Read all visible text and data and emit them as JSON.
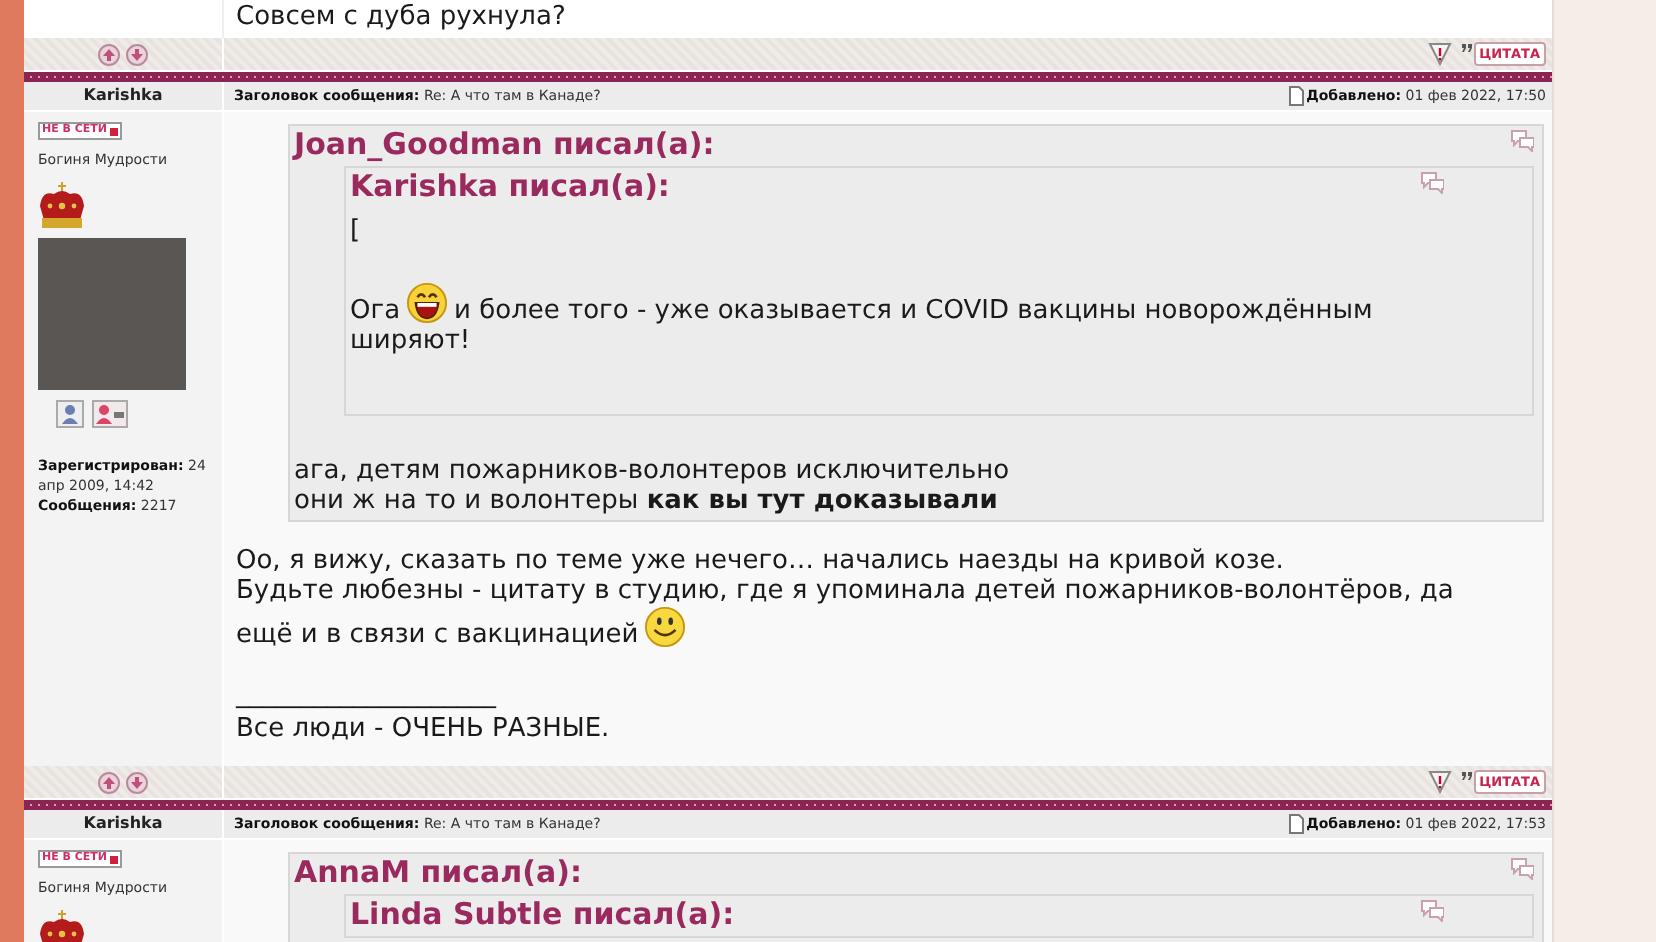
{
  "previous_post": {
    "body_tail": "Совсем с дуба рухнула?",
    "footer": {
      "quote_button": "ЦИТАТА"
    }
  },
  "posts": [
    {
      "author": "Karishka",
      "subject_label": "Заголовок сообщения:",
      "subject": "Re: А что там в Канаде?",
      "added_label": "Добавлено:",
      "added": "01 фев 2022, 17:50",
      "profile": {
        "status_badge": "НЕ В СЕТИ",
        "rank": "Богиня Мудрости",
        "rank_image": true,
        "avatar": true,
        "contact_icons": true,
        "registered_label": "Зарегистрирован:",
        "registered": "24 апр 2009, 14:42",
        "posts_label": "Сообщения:",
        "posts": "2217"
      },
      "body": [
        {
          "kind": "quote",
          "author_line": "Joan_Goodman писал(а):",
          "body": [
            {
              "kind": "quote",
              "author_line": "Karishka писал(а):",
              "body": [
                {
                  "kind": "paragraph",
                  "lines": [
                    [
                      {
                        "kind": "text",
                        "text": "["
                      }
                    ]
                  ]
                },
                {
                  "kind": "paragraph",
                  "lines": [
                    [
                      {
                        "kind": "text",
                        "text": "Ога"
                      },
                      {
                        "kind": "laughing_smiley"
                      },
                      {
                        "kind": "text",
                        "text": "и более того - уже оказывается и COVID вакцины новорождённым ширяют!"
                      }
                    ]
                  ]
                }
              ]
            },
            {
              "kind": "paragraph",
              "lines": [
                [
                  {
                    "kind": "text",
                    "text": "ага, детям пожарников-волонтеров исключительно"
                  }
                ],
                [
                  {
                    "kind": "text",
                    "text": "они ж на то и волонтеры **как вы тут доказывали**"
                  }
                ]
              ]
            }
          ]
        },
        {
          "kind": "paragraph",
          "lines": [
            [
              {
                "kind": "text",
                "text": "Оо, я вижу, сказать по теме уже нечего… начались наезды на кривой козе."
              }
            ],
            [
              {
                "kind": "text",
                "text": "Будьте любезны - цитату в студию, где я упоминала детей пожарников-волонтёров, да ещё и в связи с вакцинацией"
              },
              {
                "kind": "smiley"
              }
            ]
          ]
        },
        {
          "kind": "signature",
          "rule": "____________________",
          "text": "Все люди - ОЧЕНЬ РАЗНЫЕ."
        }
      ],
      "footer": {
        "quote_button": "ЦИТАТА"
      }
    },
    {
      "author": "Karishka",
      "subject_label": "Заголовок сообщения:",
      "subject": "Re: А что там в Канаде?",
      "added_label": "Добавлено:",
      "added": "01 фев 2022, 17:53",
      "profile": {
        "status_badge": "НЕ В СЕТИ",
        "rank": "Богиня Мудрости",
        "rank_image": true
      },
      "body": [
        {
          "kind": "quote",
          "author_line": "AnnaM писал(а):",
          "body": [
            {
              "kind": "quote",
              "author_line": "Linda Subtle писал(а):"
            }
          ]
        }
      ]
    }
  ]
}
